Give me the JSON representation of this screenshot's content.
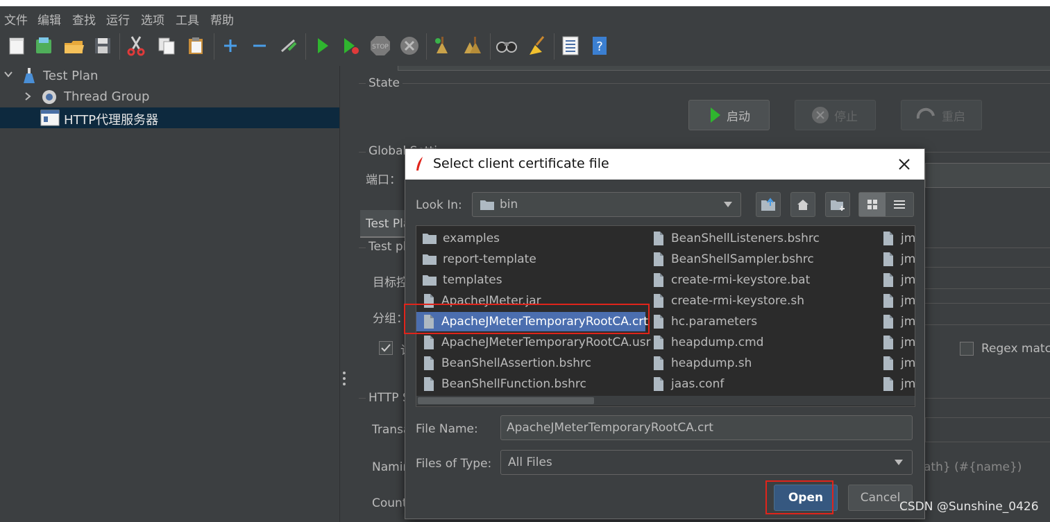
{
  "menu": [
    "文件",
    "编辑",
    "查找",
    "运行",
    "选项",
    "工具",
    "帮助"
  ],
  "toolbar_icons": [
    "new-icon",
    "templates-icon",
    "open-icon",
    "save-icon",
    "cut-icon",
    "copy-icon",
    "paste-icon",
    "expand-icon",
    "collapse-icon",
    "toggle-icon",
    "start-icon",
    "start-no-timers-icon",
    "stop-icon",
    "shutdown-icon",
    "clear-icon",
    "clear-all-icon",
    "search-icon",
    "reset-search-icon",
    "function-helper-icon",
    "help-icon"
  ],
  "tree": {
    "items": [
      {
        "label": "Test Plan"
      },
      {
        "label": "Thread Group"
      },
      {
        "label": "HTTP代理服务器"
      }
    ]
  },
  "proxy": {
    "state_label": "State",
    "start_label": "启动",
    "stop_label": "停止",
    "restart_label": "重启",
    "global_settings_label": "Global Setti",
    "port_label": "端口：",
    "tab_test_plan": "Test Pla",
    "test_plan_content_label": "Test pl",
    "target_controller_label": "目标控",
    "grouping_label": "分组：",
    "checkbox_short": "记",
    "regex_match_label": "Regex match",
    "http_sampler_label": "HTTP S",
    "transaction_label": "Transa",
    "naming_label": "Namin",
    "counter_label": "Count",
    "naming_suffix": "ath} (#{name})"
  },
  "dialog": {
    "title": "Select client certificate file",
    "look_in_label": "Look In:",
    "look_in_value": "bin",
    "file_name_label": "File Name:",
    "file_name_value": "ApacheJMeterTemporaryRootCA.crt",
    "files_of_type_label": "Files of Type:",
    "files_of_type_value": "All Files",
    "open_label": "Open",
    "cancel_label": "Cancel",
    "files_col1": [
      {
        "name": "examples",
        "type": "folder"
      },
      {
        "name": "report-template",
        "type": "folder"
      },
      {
        "name": "templates",
        "type": "folder"
      },
      {
        "name": "ApacheJMeter.jar",
        "type": "file"
      },
      {
        "name": "ApacheJMeterTemporaryRootCA.crt",
        "type": "file",
        "selected": true
      },
      {
        "name": "ApacheJMeterTemporaryRootCA.usr",
        "type": "file"
      },
      {
        "name": "BeanShellAssertion.bshrc",
        "type": "file"
      },
      {
        "name": "BeanShellFunction.bshrc",
        "type": "file"
      }
    ],
    "files_col2": [
      {
        "name": "BeanShellListeners.bshrc",
        "type": "file"
      },
      {
        "name": "BeanShellSampler.bshrc",
        "type": "file"
      },
      {
        "name": "create-rmi-keystore.bat",
        "type": "file"
      },
      {
        "name": "create-rmi-keystore.sh",
        "type": "file"
      },
      {
        "name": "hc.parameters",
        "type": "file"
      },
      {
        "name": "heapdump.cmd",
        "type": "file"
      },
      {
        "name": "heapdump.sh",
        "type": "file"
      },
      {
        "name": "jaas.conf",
        "type": "file"
      }
    ],
    "files_col3": [
      {
        "name": "jm",
        "type": "file"
      },
      {
        "name": "jm",
        "type": "file"
      },
      {
        "name": "jm",
        "type": "file"
      },
      {
        "name": "jm",
        "type": "file"
      },
      {
        "name": "jm",
        "type": "file"
      },
      {
        "name": "jm",
        "type": "file"
      },
      {
        "name": "jm",
        "type": "file"
      },
      {
        "name": "jm",
        "type": "file"
      }
    ]
  },
  "watermark": "CSDN @Sunshine_0426",
  "colors": {
    "bg": "#3c3f41",
    "selection": "#4b6eaf",
    "tree_selection": "#0d293e",
    "highlight": "#e0241b"
  }
}
